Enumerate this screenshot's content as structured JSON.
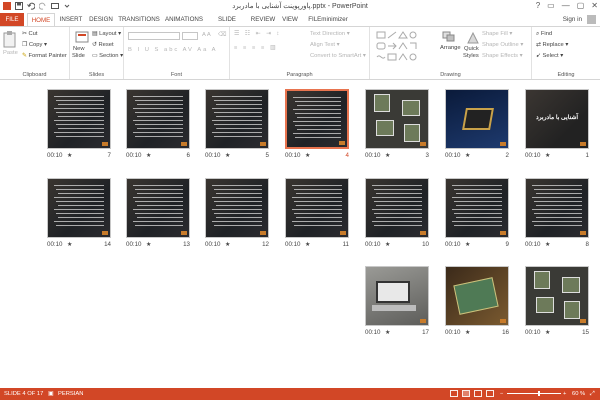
{
  "window": {
    "title": "پاورپوینت آشنایی با مادربرد.pptx - PowerPoint",
    "controls": [
      "?",
      "▭",
      "—",
      "▢",
      "✕"
    ]
  },
  "tabs": [
    "FILE",
    "HOME",
    "INSERT",
    "DESIGN",
    "TRANSITIONS",
    "ANIMATIONS",
    "SLIDE SHOW",
    "REVIEW",
    "VIEW",
    "FILEminimizer"
  ],
  "active_tab": "HOME",
  "sign_in": "Sign in",
  "ribbon": {
    "clipboard": {
      "label": "Clipboard",
      "paste": "Paste",
      "cut": "Cut",
      "copy": "Copy",
      "format_painter": "Format Painter"
    },
    "slides": {
      "label": "Slides",
      "new_slide_1": "New",
      "new_slide_2": "Slide",
      "layout": "Layout",
      "reset": "Reset",
      "section": "Section"
    },
    "font": {
      "label": "Font"
    },
    "paragraph": {
      "label": "Paragraph",
      "text_direction": "Text Direction",
      "align_text": "Align Text",
      "convert_smartart": "Convert to SmartArt"
    },
    "drawing": {
      "label": "Drawing",
      "arrange": "Arrange",
      "quick_styles_1": "Quick",
      "quick_styles_2": "Styles",
      "shape_fill": "Shape Fill",
      "shape_outline": "Shape Outline",
      "shape_effects": "Shape Effects"
    },
    "editing": {
      "label": "Editing",
      "find": "Find",
      "replace": "Replace",
      "select": "Select"
    }
  },
  "slides": [
    {
      "number": "1",
      "time": "00:10",
      "star": "★",
      "kind": "title",
      "title_text": "آشنایی با مادربرد"
    },
    {
      "number": "2",
      "time": "00:10",
      "star": "★",
      "kind": "chip"
    },
    {
      "number": "3",
      "time": "00:10",
      "star": "★",
      "kind": "photos"
    },
    {
      "number": "4",
      "time": "00:10",
      "star": "★",
      "kind": "text",
      "selected": true
    },
    {
      "number": "5",
      "time": "00:10",
      "star": "★",
      "kind": "text"
    },
    {
      "number": "6",
      "time": "00:10",
      "star": "★",
      "kind": "text"
    },
    {
      "number": "7",
      "time": "00:10",
      "star": "★",
      "kind": "text"
    },
    {
      "number": "8",
      "time": "00:10",
      "star": "★",
      "kind": "text"
    },
    {
      "number": "9",
      "time": "00:10",
      "star": "★",
      "kind": "text"
    },
    {
      "number": "10",
      "time": "00:10",
      "star": "★",
      "kind": "text"
    },
    {
      "number": "11",
      "time": "00:10",
      "star": "★",
      "kind": "text"
    },
    {
      "number": "12",
      "time": "00:10",
      "star": "★",
      "kind": "text"
    },
    {
      "number": "13",
      "time": "00:10",
      "star": "★",
      "kind": "text"
    },
    {
      "number": "14",
      "time": "00:10",
      "star": "★",
      "kind": "text"
    },
    {
      "number": "15",
      "time": "00:10",
      "star": "★",
      "kind": "photos"
    },
    {
      "number": "16",
      "time": "00:10",
      "star": "★",
      "kind": "board"
    },
    {
      "number": "17",
      "time": "00:10",
      "star": "★",
      "kind": "laptop"
    }
  ],
  "status": {
    "slide_info": "SLIDE 4 OF 17",
    "language": "PERSIAN",
    "zoom": "60 %",
    "zoom_level": 0.6
  },
  "colors": {
    "accent": "#d24726",
    "selection": "#e8744f"
  }
}
